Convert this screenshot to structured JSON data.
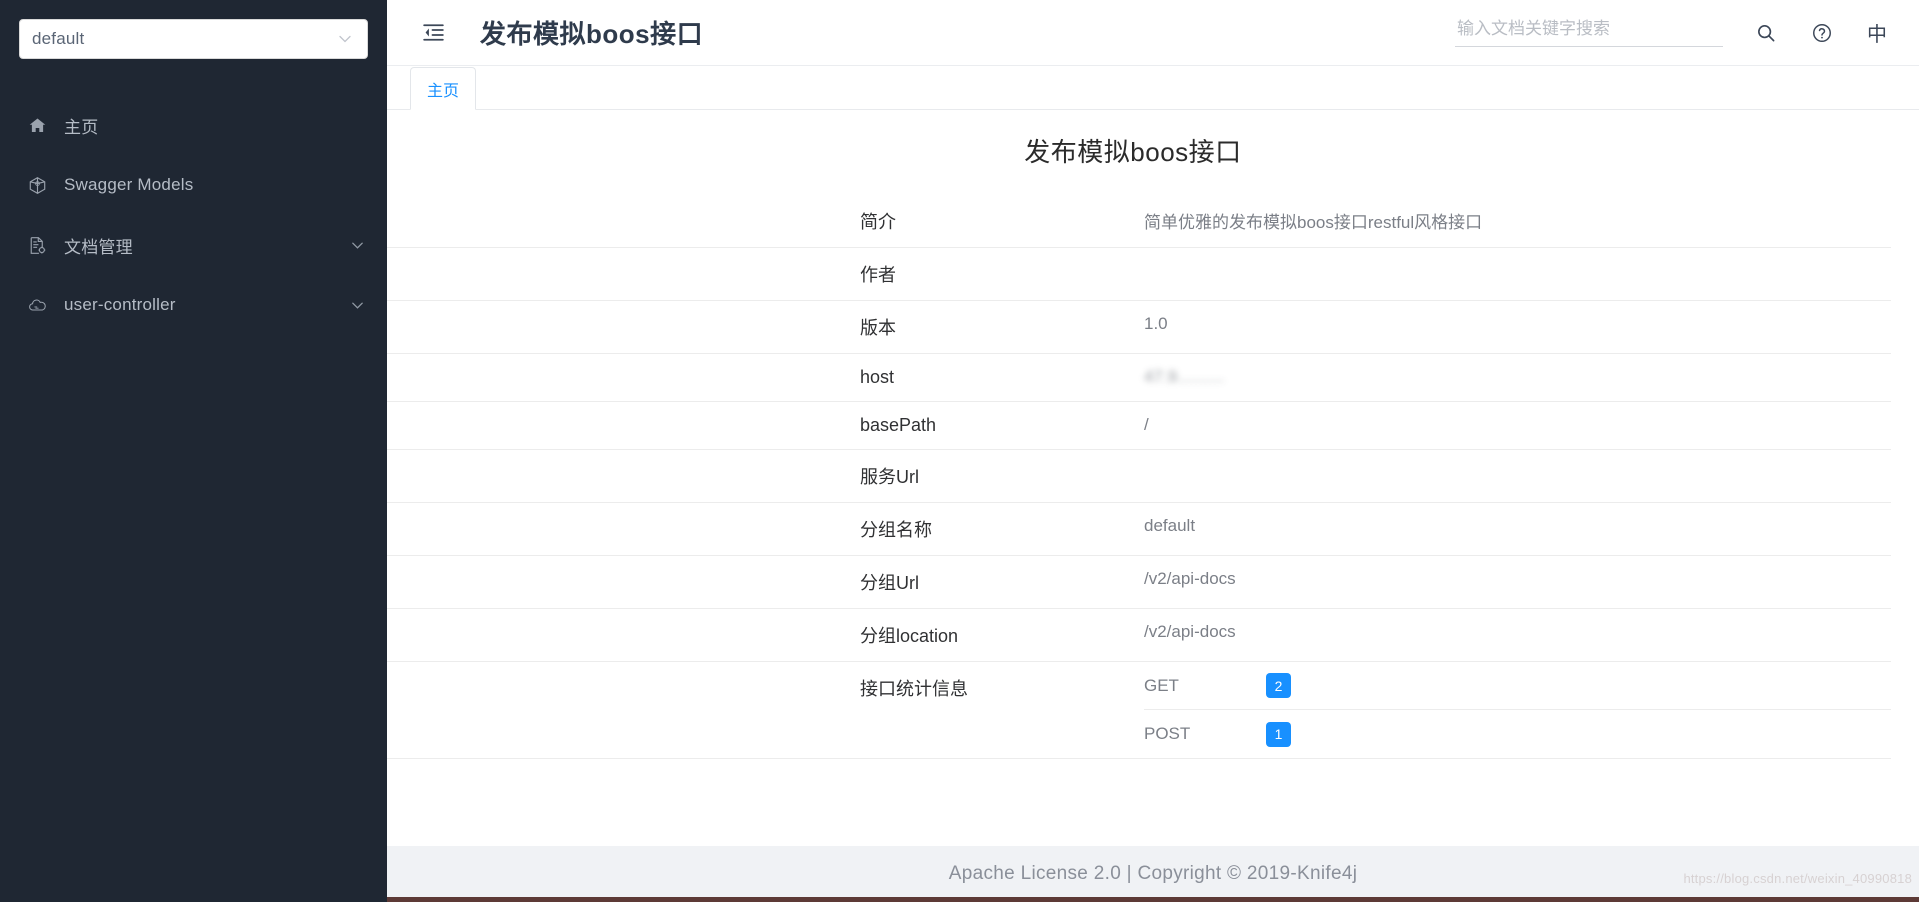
{
  "sidebar": {
    "group_select": {
      "value": "default",
      "chevron_icon": "chevron-down-icon"
    },
    "items": [
      {
        "label": "主页",
        "icon": "home-icon",
        "expandable": false
      },
      {
        "label": "Swagger Models",
        "icon": "cube-icon",
        "expandable": false
      },
      {
        "label": "文档管理",
        "icon": "file-settings-icon",
        "expandable": true
      },
      {
        "label": "user-controller",
        "icon": "cloud-icon",
        "expandable": true
      }
    ]
  },
  "topbar": {
    "fold_icon": "menu-fold-icon",
    "title": "发布模拟boos接口",
    "search": {
      "placeholder": "输入文档关键字搜索",
      "value": ""
    },
    "search_icon": "search-icon",
    "help_icon": "question-circle-icon",
    "language": "中"
  },
  "tabs": [
    {
      "label": "主页",
      "active": true
    }
  ],
  "doc": {
    "title": "发布模拟boos接口",
    "rows": [
      {
        "label": "简介",
        "value": "简单优雅的发布模拟boos接口restful风格接口",
        "blurred": false
      },
      {
        "label": "作者",
        "value": "",
        "blurred": false
      },
      {
        "label": "版本",
        "value": "1.0",
        "blurred": false
      },
      {
        "label": "host",
        "value": "47.9..........",
        "blurred": true
      },
      {
        "label": "basePath",
        "value": "/",
        "blurred": false
      },
      {
        "label": "服务Url",
        "value": "",
        "blurred": false
      },
      {
        "label": "分组名称",
        "value": "default",
        "blurred": false
      },
      {
        "label": "分组Url",
        "value": "/v2/api-docs",
        "blurred": false
      },
      {
        "label": "分组location",
        "value": "/v2/api-docs",
        "blurred": false
      }
    ],
    "stats": {
      "label": "接口统计信息",
      "methods": [
        {
          "method": "GET",
          "count": "2"
        },
        {
          "method": "POST",
          "count": "1"
        }
      ]
    }
  },
  "footer": {
    "text": "Apache License 2.0 | Copyright © 2019-Knife4j",
    "watermark": "https://blog.csdn.net/weixin_40990818"
  },
  "colors": {
    "sidebar_bg": "#1f2733",
    "accent": "#1890ff",
    "badge_bg": "#1890ff",
    "footer_bg": "#f0f2f5"
  }
}
